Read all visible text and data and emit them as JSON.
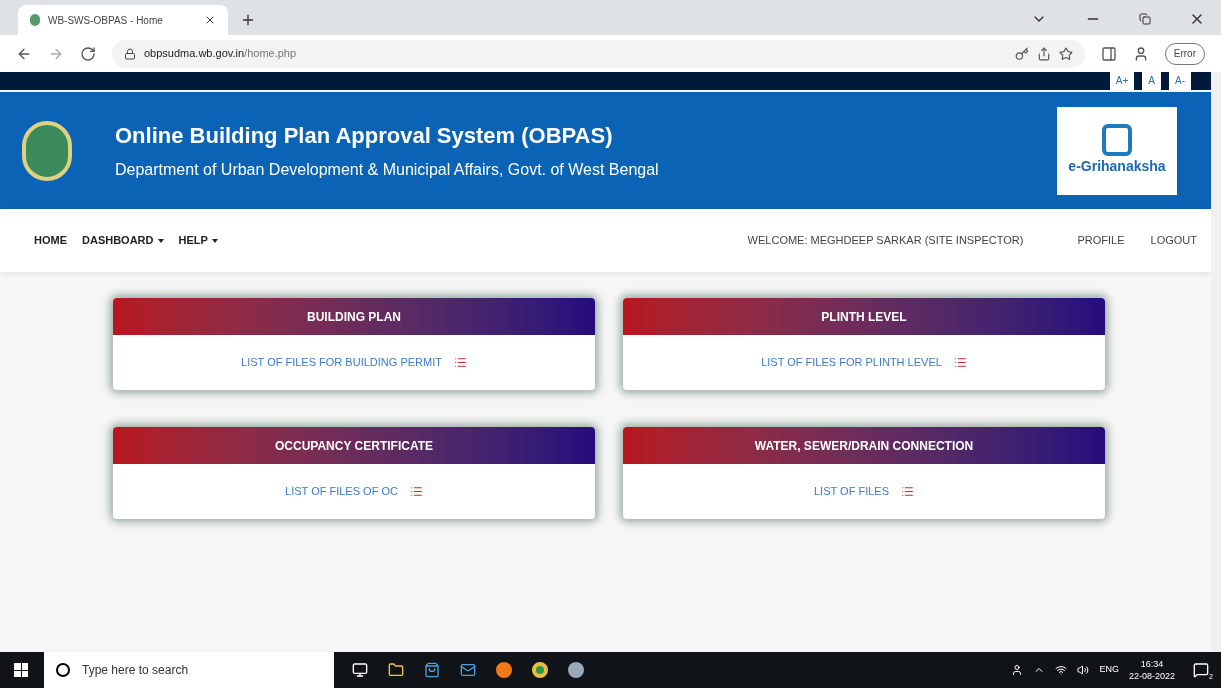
{
  "browser": {
    "tabs": [
      {
        "title": "WB-SWS-OBPAS - Home",
        "selected": true
      }
    ],
    "url_host": "obpsudma.wb.gov.in",
    "url_path": "/home.php",
    "profile_button": "Error"
  },
  "font_size_buttons": [
    "A+",
    "A",
    "A-"
  ],
  "header": {
    "title": "Online Building Plan Approval System (OBPAS)",
    "subtitle": "Department of Urban Development & Municipal Affairs, Govt. of West Bengal",
    "logo_text": "e-Grihanaksha"
  },
  "nav": {
    "items": [
      {
        "label": "HOME",
        "dropdown": false
      },
      {
        "label": "DASHBOARD",
        "dropdown": true
      },
      {
        "label": "HELP",
        "dropdown": true
      }
    ],
    "welcome": "WELCOME: MEGHDEEP SARKAR (SITE INSPECTOR)",
    "right_links": [
      "PROFILE",
      "LOGOUT"
    ]
  },
  "cards": [
    {
      "title": "BUILDING PLAN",
      "link": "LIST OF FILES FOR BUILDING PERMIT"
    },
    {
      "title": "PLINTH LEVEL",
      "link": "LIST OF FILES FOR PLINTH LEVEL"
    },
    {
      "title": "OCCUPANCY CERTIFICATE",
      "link": "LIST OF FILES OF OC"
    },
    {
      "title": "WATER, SEWER/DRAIN CONNECTION",
      "link": "LIST OF FILES"
    }
  ],
  "taskbar": {
    "search_placeholder": "Type here to search",
    "language": "ENG",
    "time": "16:34",
    "date": "22-08-2022",
    "notifications": "2"
  }
}
